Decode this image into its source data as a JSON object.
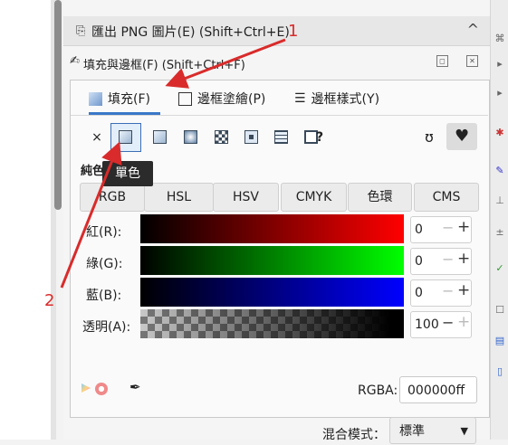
{
  "export_bar": {
    "label": "匯出 PNG 圖片(E) (Shift+Ctrl+E)",
    "chevron": "^"
  },
  "fill_header": {
    "label": "填充與邊框(F) (Shift+Ctrl+F)"
  },
  "tabs": [
    {
      "label": "填充(F)",
      "icon": "fill-swatch-icon",
      "active": true
    },
    {
      "label": "邊框塗繪(P)",
      "icon": "stroke-paint-icon",
      "active": false
    },
    {
      "label": "邊框樣式(Y)",
      "icon": "stroke-style-icon",
      "active": false
    }
  ],
  "paint_types": {
    "none": "×",
    "unknown": "?"
  },
  "tooltip": "單色",
  "flat_color_label": "純色",
  "modes": [
    "RGB",
    "HSL",
    "HSV",
    "CMYK",
    "色環",
    "CMS"
  ],
  "channels": [
    {
      "label": "紅(R):",
      "value": "0"
    },
    {
      "label": "綠(G):",
      "value": "0"
    },
    {
      "label": "藍(B):",
      "value": "0"
    },
    {
      "label": "透明(A):",
      "value": "100"
    }
  ],
  "rgba": {
    "label": "RGBA:",
    "value": "000000ff"
  },
  "blend": {
    "label": "混合模式：",
    "value": "標準"
  },
  "annotations": [
    "1",
    "2"
  ],
  "colors": {
    "accent": "#3a78c8",
    "annotation": "#d92b2b"
  }
}
